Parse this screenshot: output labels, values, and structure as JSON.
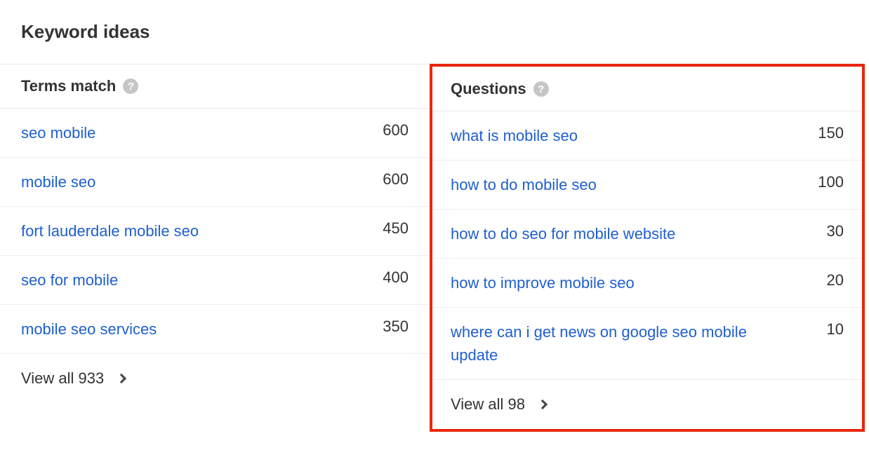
{
  "title": "Keyword ideas",
  "terms": {
    "header": "Terms match",
    "rows": [
      {
        "term": "seo mobile",
        "value": "600"
      },
      {
        "term": "mobile seo",
        "value": "600"
      },
      {
        "term": "fort lauderdale mobile seo",
        "value": "450"
      },
      {
        "term": "seo for mobile",
        "value": "400"
      },
      {
        "term": "mobile seo services",
        "value": "350"
      }
    ],
    "view_all": "View all 933"
  },
  "questions": {
    "header": "Questions",
    "rows": [
      {
        "term": "what is mobile seo",
        "value": "150"
      },
      {
        "term": "how to do mobile seo",
        "value": "100"
      },
      {
        "term": "how to do seo for mobile website",
        "value": "30"
      },
      {
        "term": "how to improve mobile seo",
        "value": "20"
      },
      {
        "term": "where can i get news on google seo mobile update",
        "value": "10"
      }
    ],
    "view_all": "View all 98"
  }
}
